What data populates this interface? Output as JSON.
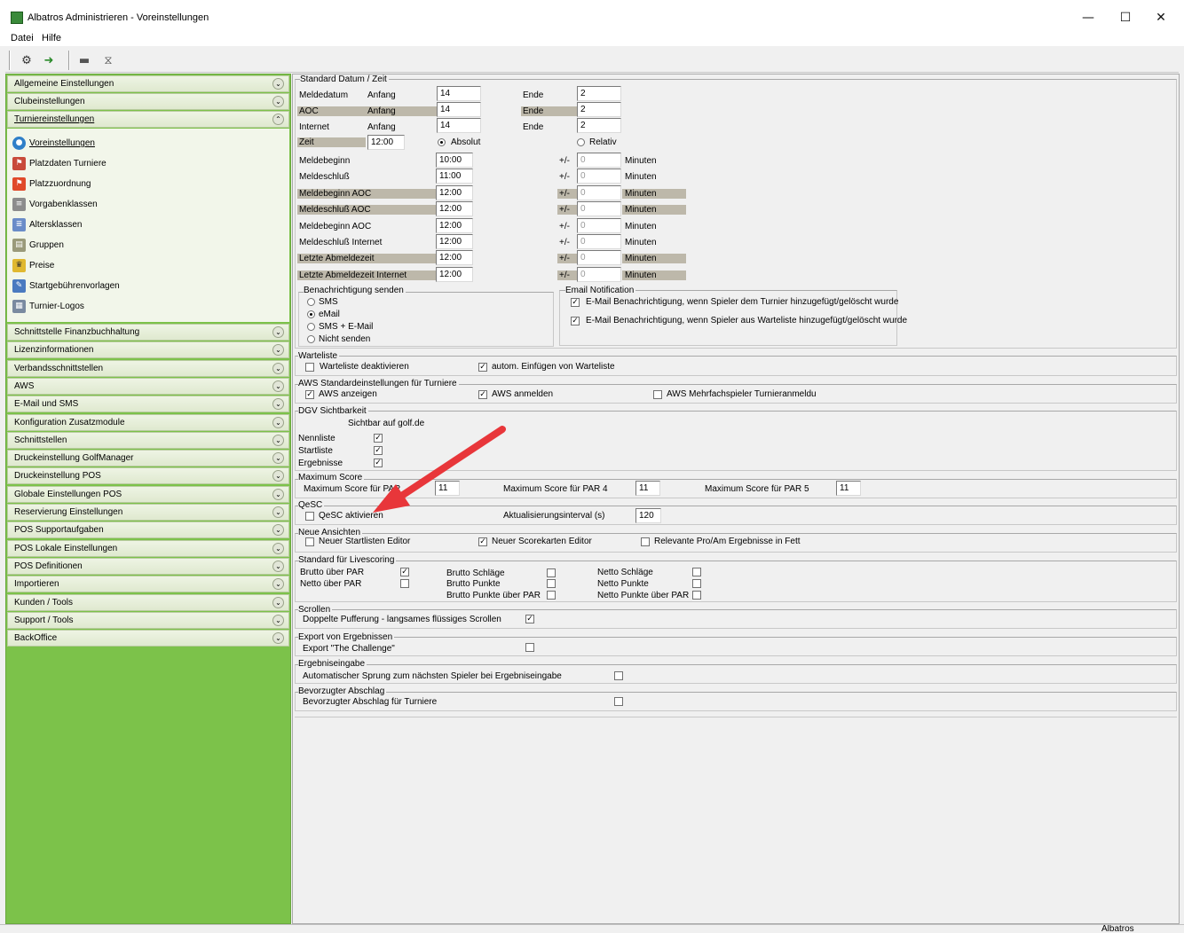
{
  "window": {
    "title": "Albatros Administrieren - Voreinstellungen",
    "minimize": "—",
    "maximize": "☐",
    "close": "✕"
  },
  "menu": [
    "Datei",
    "Hilfe"
  ],
  "sidebar": {
    "top_sections": [
      "Allgemeine Einstellungen",
      "Clubeinstellungen",
      "Turniereinstellungen"
    ],
    "items": [
      "Voreinstellungen",
      "Platzdaten Turniere",
      "Platzzuordnung",
      "Vorgabenklassen",
      "Altersklassen",
      "Gruppen",
      "Preise",
      "Startgebührenvorlagen",
      "Turnier-Logos"
    ],
    "sections": [
      "Schnittstelle Finanzbuchhaltung",
      "Lizenzinformationen",
      "Verbandsschnittstellen",
      "AWS",
      "E-Mail und SMS",
      "Konfiguration Zusatzmodule",
      "Schnittstellen",
      "Druckeinstellung GolfManager",
      "Druckeinstellung POS",
      "Globale Einstellungen POS",
      "Reservierung Einstellungen",
      "POS Supportaufgaben",
      "POS Lokale Einstellungen",
      "POS Definitionen",
      "Importieren",
      "Kunden / Tools",
      "Support / Tools",
      "BackOffice"
    ]
  },
  "datum": {
    "group": "Standard Datum / Zeit",
    "rows": [
      {
        "label": "Meldedatum",
        "anfang": "Anfang",
        "von": "14",
        "ende": "Ende",
        "bis": "2"
      },
      {
        "label": "AOC",
        "anfang": "Anfang",
        "von": "14",
        "ende": "Ende",
        "bis": "2"
      },
      {
        "label": "Internet",
        "anfang": "Anfang",
        "von": "14",
        "ende": "Ende",
        "bis": "2"
      }
    ],
    "zeit_label": "Zeit",
    "zeit_value": "12:00",
    "absolut": "Absolut",
    "relativ": "Relativ",
    "times": [
      {
        "label": "Meldebeginn",
        "value": "10:00",
        "pm": "+/-",
        "min": "0",
        "unit": "Minuten"
      },
      {
        "label": "Meldeschluß",
        "value": "11:00",
        "pm": "+/-",
        "min": "0",
        "unit": "Minuten"
      },
      {
        "label": "Meldebeginn AOC",
        "value": "12:00",
        "pm": "+/-",
        "min": "0",
        "unit": "Minuten"
      },
      {
        "label": "Meldeschluß AOC",
        "value": "12:00",
        "pm": "+/-",
        "min": "0",
        "unit": "Minuten"
      },
      {
        "label": "Meldebeginn AOC",
        "value": "12:00",
        "pm": "+/-",
        "min": "0",
        "unit": "Minuten"
      },
      {
        "label": "Meldeschluß Internet",
        "value": "12:00",
        "pm": "+/-",
        "min": "0",
        "unit": "Minuten"
      },
      {
        "label": "Letzte Abmeldezeit",
        "value": "12:00",
        "pm": "+/-",
        "min": "0",
        "unit": "Minuten"
      },
      {
        "label": "Letzte Abmeldezeit Internet",
        "value": "12:00",
        "pm": "+/-",
        "min": "0",
        "unit": "Minuten"
      }
    ]
  },
  "benachrichtigung": {
    "group": "Benachrichtigung senden",
    "options": [
      "SMS",
      "eMail",
      "SMS + E-Mail",
      "Nicht senden"
    ],
    "selected": 1
  },
  "email": {
    "group": "Email Notification",
    "opt1": "E-Mail Benachrichtigung, wenn Spieler dem Turnier hinzugefügt/gelöscht wurde",
    "opt2": "E-Mail Benachrichtigung, wenn Spieler aus Warteliste hinzugefügt/gelöscht wurde"
  },
  "warteliste": {
    "group": "Warteliste",
    "deakt": "Warteliste deaktivieren",
    "autom": "autom. Einfügen von Warteliste"
  },
  "aws": {
    "group": "AWS Standardeinstellungen für Turniere",
    "anzeigen": "AWS anzeigen",
    "anmelden": "AWS anmelden",
    "mehrfach": "AWS Mehrfachspieler Turnieranmeldu"
  },
  "dgv": {
    "group": "DGV Sichtbarkeit",
    "header": "Sichtbar auf golf.de",
    "rows": [
      "Nennliste",
      "Startliste",
      "Ergebnisse"
    ]
  },
  "maxscore": {
    "group": "Maximum Score",
    "par3": "Maximum Score für PAR",
    "v3": "11",
    "par4": "Maximum Score für PAR 4",
    "v4": "11",
    "par5": "Maximum Score für PAR 5",
    "v5": "11"
  },
  "qesc": {
    "group": "QeSC",
    "aktiv": "QeSC aktivieren",
    "interval_label": "Aktualisierungsinterval (s)",
    "interval": "120"
  },
  "ansichten": {
    "group": "Neue Ansichten",
    "start": "Neuer Startlisten Editor",
    "score": "Neuer Scorekarten Editor",
    "proam": "Relevante Pro/Am Ergebnisse in Fett"
  },
  "livescoring": {
    "group": "Standard für Livescoring",
    "items": [
      "Brutto über PAR",
      "Netto über PAR",
      "Brutto Schläge",
      "Brutto Punkte",
      "Brutto Punkte über PAR",
      "Netto Schläge",
      "Netto Punkte",
      "Netto Punkte über PAR"
    ]
  },
  "scrollen": {
    "group": "Scrollen",
    "label": "Doppelte Pufferung - langsames flüssiges Scrollen"
  },
  "export": {
    "group": "Export von Ergebnissen",
    "label": "Export \"The Challenge\""
  },
  "ergebnis": {
    "group": "Ergebniseingabe",
    "label": "Automatischer Sprung zum nächsten Spieler bei Ergebniseingabe"
  },
  "abschlag": {
    "group": "Bevorzugter Abschlag",
    "label": "Bevorzugter Abschlag für Turniere"
  },
  "status": {
    "app": "Albatros"
  },
  "colors": {
    "sidebar": "#7cc24a",
    "arrow": "#e8363a",
    "shade": "#bdb8aa"
  }
}
